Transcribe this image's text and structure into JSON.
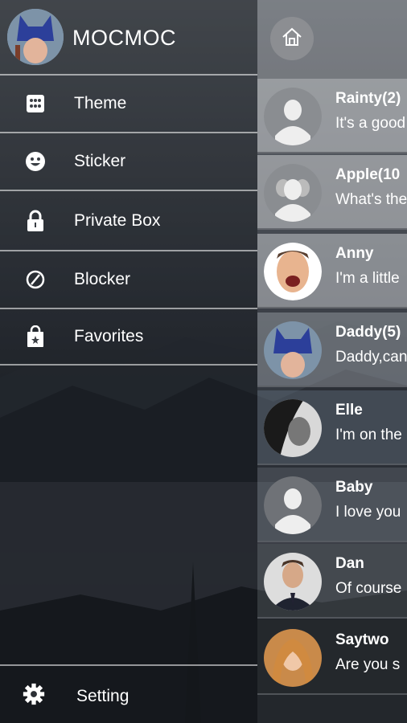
{
  "drawer": {
    "app_name": "MOCMOC",
    "menu": [
      {
        "label": "Theme",
        "icon": "grid-icon"
      },
      {
        "label": "Sticker",
        "icon": "smiley-icon"
      },
      {
        "label": "Private Box",
        "icon": "lock-icon"
      },
      {
        "label": "Blocker",
        "icon": "block-icon"
      },
      {
        "label": "Favorites",
        "icon": "bag-star-icon"
      }
    ],
    "setting_label": "Setting"
  },
  "chats": [
    {
      "name": "Rainty(2)",
      "message": "It's a good",
      "avatar": "default-person"
    },
    {
      "name": "Apple(10",
      "message": "What's the",
      "avatar": "default-group"
    },
    {
      "name": "Anny",
      "message": "I'm a little",
      "avatar": "photo"
    },
    {
      "name": "Daddy(5)",
      "message": "Daddy,can",
      "avatar": "photo"
    },
    {
      "name": "Elle",
      "message": "I'm on the",
      "avatar": "photo"
    },
    {
      "name": "Baby",
      "message": "I love you",
      "avatar": "default-person"
    },
    {
      "name": "Dan",
      "message": "Of course",
      "avatar": "photo"
    },
    {
      "name": "Saytwo",
      "message": "Are you s",
      "avatar": "photo"
    }
  ]
}
